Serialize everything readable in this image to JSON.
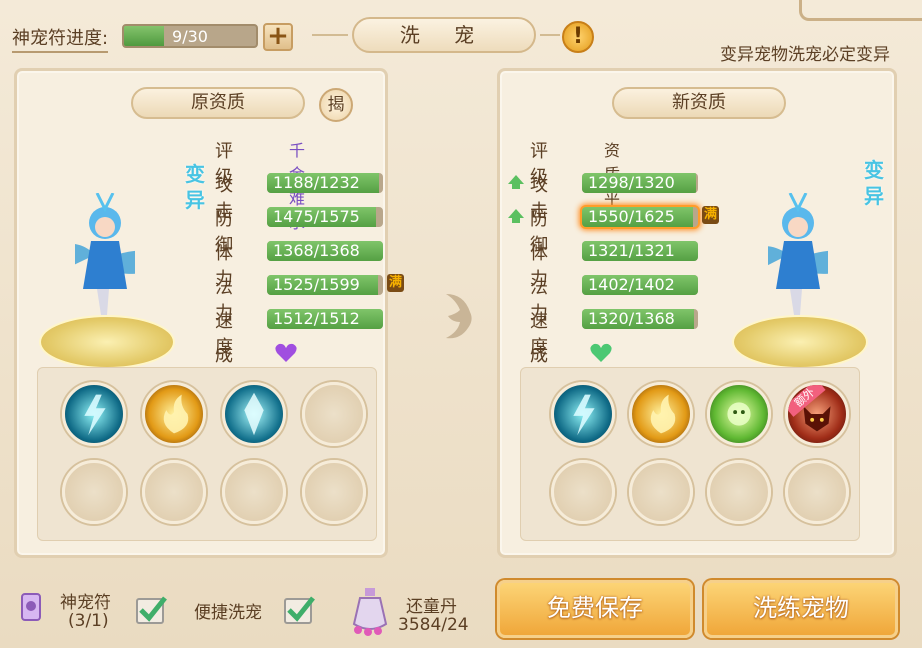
{
  "header": {
    "progress_label": "神宠符进度:",
    "progress_text": "9/30",
    "progress_value": 0.3,
    "plus": "+",
    "title": "洗 宠",
    "warn": "!",
    "notice": "变异宠物洗宠必定变异"
  },
  "left": {
    "section_title": "原资质",
    "reveal_button": "揭",
    "mutation": [
      "变",
      "异"
    ],
    "rating_label": "评级",
    "rating": "千金难求",
    "stats": [
      {
        "label": "攻击",
        "text": "1188/1232",
        "ratio": 0.964
      },
      {
        "label": "防御",
        "text": "1475/1575",
        "ratio": 0.937
      },
      {
        "label": "体力",
        "text": "1368/1368",
        "ratio": 1.0
      },
      {
        "label": "法力",
        "text": "1525/1599",
        "ratio": 0.954,
        "max": "满"
      },
      {
        "label": "速度",
        "text": "1512/1512",
        "ratio": 1.0
      }
    ],
    "growth_label": "成长",
    "growth_color": "#a04ee0"
  },
  "right": {
    "section_title": "新资质",
    "mutation": [
      "变",
      "异"
    ],
    "rating_label": "评级",
    "rating": "资质平平",
    "stats": [
      {
        "label": "攻击",
        "text": "1298/1320",
        "ratio": 0.983,
        "up": true
      },
      {
        "label": "防御",
        "text": "1550/1625",
        "ratio": 0.954,
        "up": true,
        "max": "满"
      },
      {
        "label": "体力",
        "text": "1321/1321",
        "ratio": 1.0
      },
      {
        "label": "法力",
        "text": "1402/1402",
        "ratio": 1.0
      },
      {
        "label": "速度",
        "text": "1320/1368",
        "ratio": 0.965
      }
    ],
    "growth_label": "成长",
    "growth_color": "#4cc873",
    "extra_badge": "额外"
  },
  "bottom": {
    "charm_label": "神宠符",
    "charm_count": "(3/1)",
    "quick_wash_label": "便捷洗宠",
    "item_name": "还童丹",
    "item_count": "3584/24",
    "save_button": "免费保存",
    "wash_button": "洗练宠物"
  }
}
